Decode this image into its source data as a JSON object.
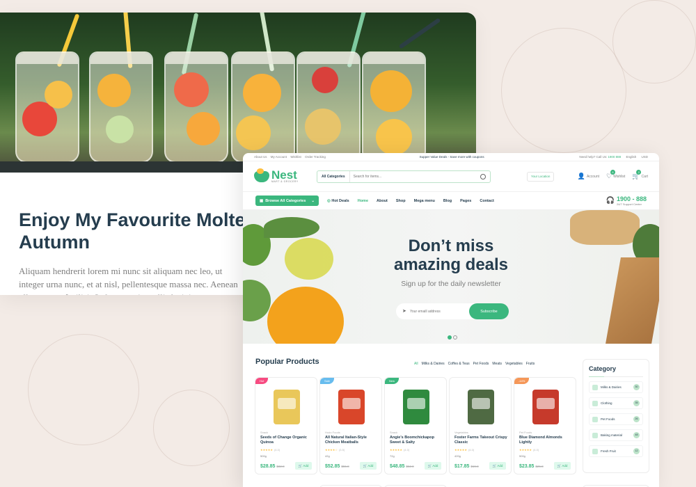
{
  "blog": {
    "title": "Enjoy My Favourite Molte Autumn",
    "excerpt": "Aliquam hendrerit lorem mi nunc sit aliquam nec leo, ut integer urna nunc, et at nisl, pellentesque massa nec. Aenean ullamcorper facilisi. Sed venenatis mollis lacinia."
  },
  "topbar": {
    "links": [
      "About Us",
      "My Account",
      "Wishlist",
      "Order Tracking"
    ],
    "promo": "Supper Value Deals - Save more with coupons",
    "help_label": "Need help? Call Us:",
    "help_phone": "1900 888",
    "language": "English",
    "currency": "USD"
  },
  "header": {
    "logo_word": "Nest",
    "logo_sub": "MART & GROCERY",
    "search_category": "All Categories",
    "search_placeholder": "Search for items...",
    "location": "Your Location",
    "account": "Account",
    "wishlist": "Wishlist",
    "wishlist_count": "6",
    "cart": "Cart",
    "cart_count": "2"
  },
  "nav": {
    "browse": "Browse All Categories",
    "hot": "Hot Deals",
    "items": [
      "Home",
      "About",
      "Shop",
      "Mega menu",
      "Blog",
      "Pages",
      "Contact"
    ],
    "support_number": "1900 - 888",
    "support_label": "24/7 Support Center"
  },
  "hero": {
    "headline_1": "Don’t miss",
    "headline_2": "amazing deals",
    "subtitle": "Sign up for the daily newsletter",
    "email_placeholder": "Your emaill address",
    "subscribe": "Subscribe"
  },
  "popular": {
    "title": "Popular Products",
    "filters": [
      "All",
      "Milks & Dairies",
      "Coffes & Teas",
      "Pet Foods",
      "Meats",
      "Vegetables",
      "Fruits"
    ]
  },
  "products": [
    {
      "tag": "Hot",
      "tag_color": "#f74b81",
      "img_color": "#e9c75a",
      "category": "Snack",
      "name": "Seeds of Change Organic Quinoa",
      "rating": "(4.0)",
      "weight": "500g",
      "price": "$28.85",
      "old": "$32.8",
      "add": "Add"
    },
    {
      "tag": "Sale",
      "tag_color": "#67bcee",
      "img_color": "#d9462a",
      "category": "Hodo Foods",
      "name": "All Natural Italian-Style Chicken Meatballs",
      "rating": "(3.5)",
      "weight": "42g",
      "price": "$52.85",
      "old": "$55.8",
      "add": "Add"
    },
    {
      "tag": "New",
      "tag_color": "#3bb77e",
      "img_color": "#2f8a3e",
      "category": "Snack",
      "name": "Angie’s Boomchickapop Sweet & Salty",
      "rating": "(4.0)",
      "weight": "72g",
      "price": "$48.85",
      "old": "$52.8",
      "add": "Add"
    },
    {
      "tag": "",
      "tag_color": "",
      "img_color": "#4f6a43",
      "category": "Vegetables",
      "name": "Foster Farms Takeout Crispy Classic",
      "rating": "(4.0)",
      "weight": "420g",
      "price": "$17.85",
      "old": "$19.8",
      "add": "Add"
    },
    {
      "tag": "-14%",
      "tag_color": "#f59758",
      "img_color": "#c63a2b",
      "category": "Pet Foods",
      "name": "Blue Diamond Almonds Lightly",
      "rating": "(4.0)",
      "weight": "500g",
      "price": "$23.85",
      "old": "$25.8",
      "add": "Add"
    }
  ],
  "category": {
    "title": "Category",
    "items": [
      {
        "name": "Milks & Dairies",
        "count": "30"
      },
      {
        "name": "Clothing",
        "count": "35"
      },
      {
        "name": "Pet Foods",
        "count": "26"
      },
      {
        "name": "Baking material",
        "count": "48"
      },
      {
        "name": "Fresh Fruit",
        "count": "12"
      }
    ]
  },
  "colors": {
    "brand": "#3bb77e",
    "heading": "#253d4e",
    "muted": "#7e7e7e"
  }
}
